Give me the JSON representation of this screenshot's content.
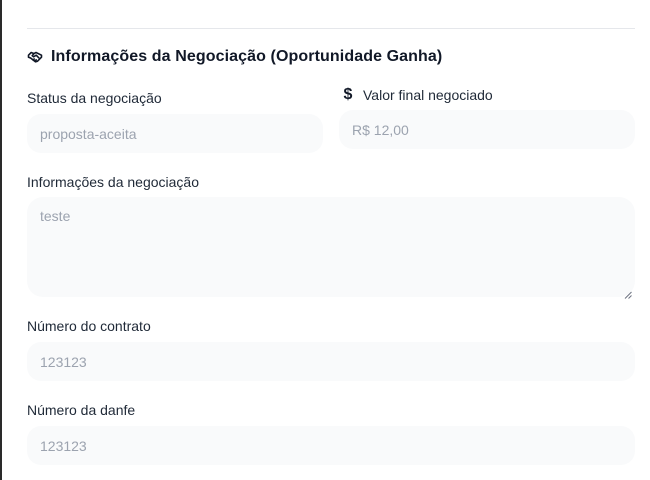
{
  "section": {
    "title": "Informações da Negociação (Oportunidade Ganha)",
    "icon": "handshake-icon"
  },
  "fields": {
    "status": {
      "label": "Status da negociação",
      "value": "proposta-aceita"
    },
    "valor": {
      "label": "Valor final negociado",
      "icon": "dollar-icon",
      "value": "R$ 12,00"
    },
    "informacoes": {
      "label": "Informações da negociação",
      "value": "teste"
    },
    "contrato": {
      "label": "Número do contrato",
      "value": "123123"
    },
    "danfe": {
      "label": "Número da danfe",
      "value": "123123"
    }
  },
  "colors": {
    "field_background": "#f9fafb",
    "field_text": "#9ca3af",
    "label_text": "#1f2937",
    "divider": "#e5e7eb"
  }
}
